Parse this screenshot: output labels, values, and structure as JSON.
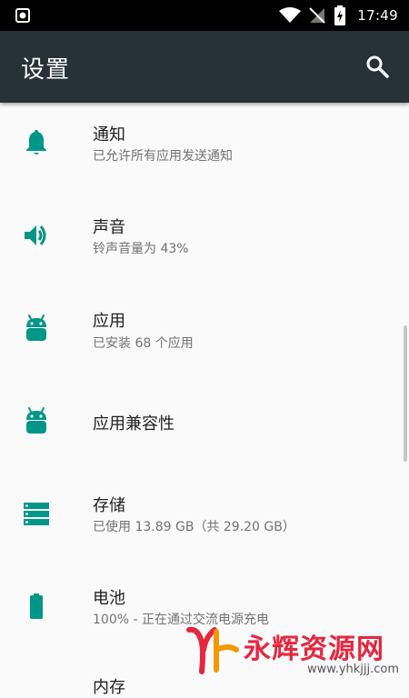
{
  "status_bar": {
    "time": "17:49",
    "icons": [
      "notification-icon",
      "wifi-icon",
      "no-sim-icon",
      "battery-charging-icon"
    ]
  },
  "toolbar": {
    "title": "设置",
    "search_icon": "search-icon"
  },
  "items": [
    {
      "title": "通知",
      "summary": "已允许所有应用发送通知",
      "icon": "bell-icon"
    },
    {
      "title": "声音",
      "summary": "铃声音量为 43%",
      "icon": "volume-icon"
    },
    {
      "title": "应用",
      "summary": "已安装 68 个应用",
      "icon": "android-icon"
    },
    {
      "title": "应用兼容性",
      "summary": "",
      "icon": "android-icon"
    },
    {
      "title": "存储",
      "summary": "已使用 13.89 GB（共 29.20 GB）",
      "icon": "storage-icon"
    },
    {
      "title": "电池",
      "summary": "100% - 正在通过交流电源充电",
      "icon": "battery-icon"
    }
  ],
  "next_item_partial": "内存",
  "watermark": {
    "text": "永辉资源网",
    "url": "www.yhkjjj.com"
  },
  "colors": {
    "accent": "#009688",
    "toolbar": "#263238",
    "background": "#fafafa"
  }
}
